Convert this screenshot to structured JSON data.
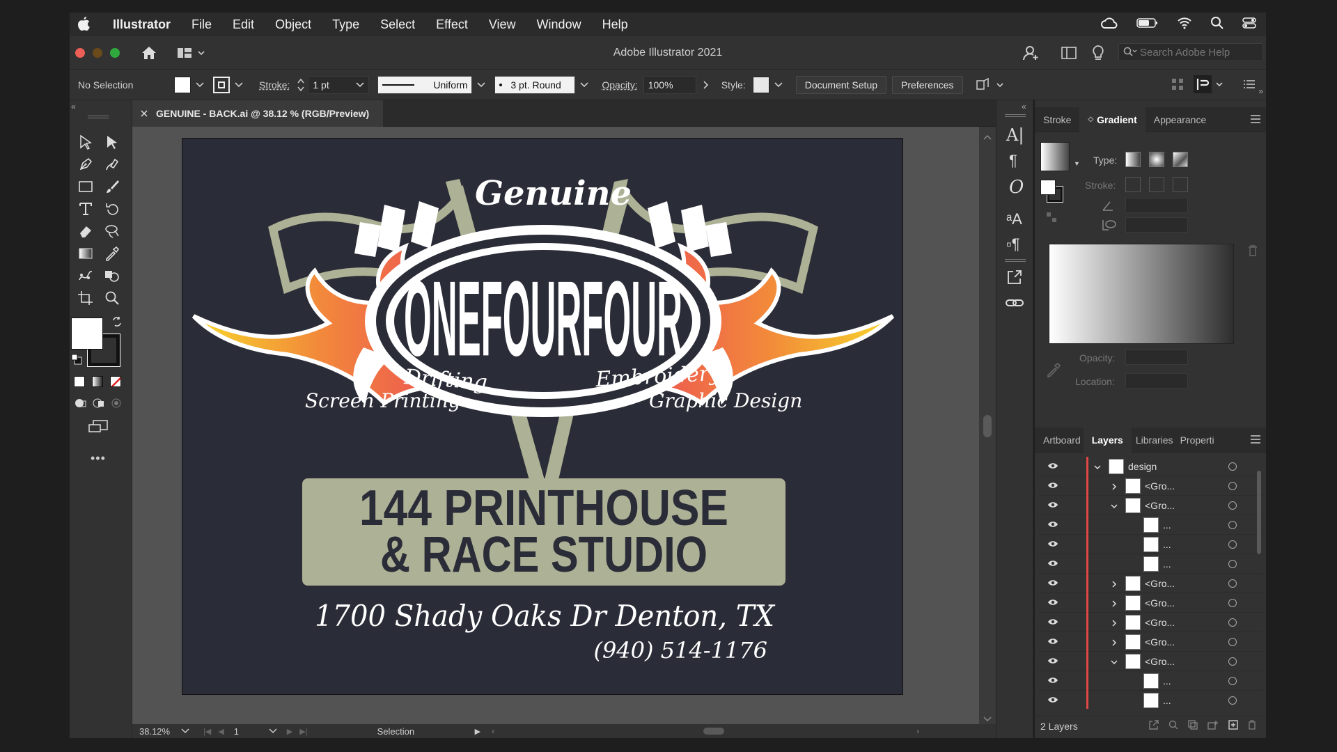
{
  "menubar": {
    "app_name": "Illustrator",
    "items": [
      "File",
      "Edit",
      "Object",
      "Type",
      "Select",
      "Effect",
      "View",
      "Window",
      "Help"
    ]
  },
  "window": {
    "title": "Adobe Illustrator 2021",
    "search_placeholder": "Search Adobe Help"
  },
  "controlbar": {
    "selection": "No Selection",
    "stroke_label": "Stroke:",
    "stroke_weight": "1 pt",
    "profile": "Uniform",
    "brush": "3 pt. Round",
    "opacity_label": "Opacity:",
    "opacity": "100%",
    "style_label": "Style:",
    "document_setup": "Document Setup",
    "preferences": "Preferences"
  },
  "document": {
    "tab_title": "GENUINE - BACK.ai @ 38.12 % (RGB/Preview)"
  },
  "artwork": {
    "genuine": "Genuine",
    "brand": "ONEFOURFOUR",
    "drifting": "Drifting",
    "embroidery": "Embroidery",
    "screen_printing": "Screen Printing",
    "graphic_design": "Graphic Design",
    "name_line1": "144 PRINTHOUSE",
    "name_line2": "& RACE STUDIO",
    "address": "1700 Shady Oaks Dr Denton, TX",
    "phone": "(940) 514-1176"
  },
  "statusbar": {
    "zoom": "38.12%",
    "artboard": "1",
    "tool": "Selection"
  },
  "gradient_panel": {
    "tabs": [
      "Stroke",
      "Gradient",
      "Appearance"
    ],
    "active": "Gradient",
    "type_label": "Type:",
    "stroke_label": "Stroke:",
    "opacity_label": "Opacity:",
    "location_label": "Location:"
  },
  "layers_panel": {
    "tabs": [
      "Artboard",
      "Layers",
      "Libraries",
      "Properti"
    ],
    "active": "Layers",
    "rows": [
      {
        "name": "design",
        "level": 0,
        "expand": "open"
      },
      {
        "name": "<Gro...",
        "level": 1,
        "expand": "closed"
      },
      {
        "name": "<Gro...",
        "level": 1,
        "expand": "open"
      },
      {
        "name": "...",
        "level": 2,
        "expand": "none"
      },
      {
        "name": "...",
        "level": 2,
        "expand": "none"
      },
      {
        "name": "...",
        "level": 2,
        "expand": "none"
      },
      {
        "name": "<Gro...",
        "level": 1,
        "expand": "closed"
      },
      {
        "name": "<Gro...",
        "level": 1,
        "expand": "closed"
      },
      {
        "name": "<Gro...",
        "level": 1,
        "expand": "closed"
      },
      {
        "name": "<Gro...",
        "level": 1,
        "expand": "closed"
      },
      {
        "name": "<Gro...",
        "level": 1,
        "expand": "open"
      },
      {
        "name": "...",
        "level": 2,
        "expand": "none"
      },
      {
        "name": "...",
        "level": 2,
        "expand": "none"
      }
    ],
    "footer": "2 Layers"
  },
  "colors": {
    "navy": "#2a2d37",
    "khaki": "#adb195",
    "flame_red": "#ec4a57",
    "flame_yellow": "#f7d62b"
  }
}
